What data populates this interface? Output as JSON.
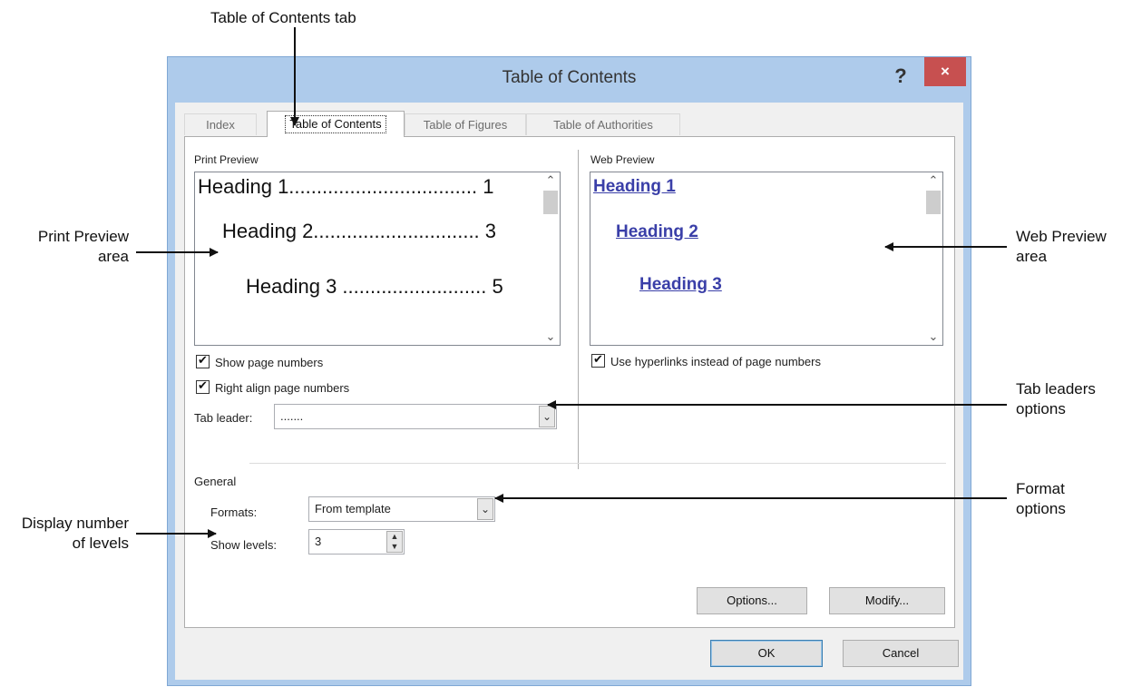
{
  "callouts": {
    "toc_tab": "Table of Contents tab",
    "print_preview": [
      "Print Preview",
      "area"
    ],
    "web_preview": [
      "Web Preview",
      "area"
    ],
    "tab_leaders": [
      "Tab leaders",
      "options"
    ],
    "format": [
      "Format",
      "options"
    ],
    "display_levels": [
      "Display number",
      "of levels"
    ]
  },
  "dialog": {
    "title": "Table of Contents",
    "help": "?",
    "close": "×",
    "tabs": [
      "Index",
      "Table of Contents",
      "Table of Figures",
      "Table of Authorities"
    ],
    "print_preview": {
      "label": "Print Preview",
      "lines": [
        "Heading 1.................................. 1",
        "Heading 2.............................. 3",
        "Heading 3 .......................... 5"
      ]
    },
    "web_preview": {
      "label": "Web Preview",
      "links": [
        "Heading 1",
        "Heading 2",
        "Heading 3"
      ]
    },
    "show_page_numbers": "Show page numbers",
    "right_align": "Right align page numbers",
    "use_hyperlinks": "Use hyperlinks instead of page numbers",
    "tab_leader_label": "Tab leader:",
    "tab_leader_value": ".......",
    "general_label": "General",
    "formats_label": "Formats:",
    "formats_value": "From template",
    "show_levels_label": "Show levels:",
    "show_levels_value": "3",
    "options_button": "Options...",
    "modify_button": "Modify...",
    "ok_button": "OK",
    "cancel_button": "Cancel"
  },
  "colors": {
    "title_bar": "#aecbeb",
    "close_button": "#c75050",
    "hyperlink": "#3a3fa8"
  },
  "icons": [
    "help-icon",
    "close-icon",
    "checkbox-checked-icon",
    "chevron-down-icon",
    "chevron-up-icon",
    "spinner-icon"
  ]
}
